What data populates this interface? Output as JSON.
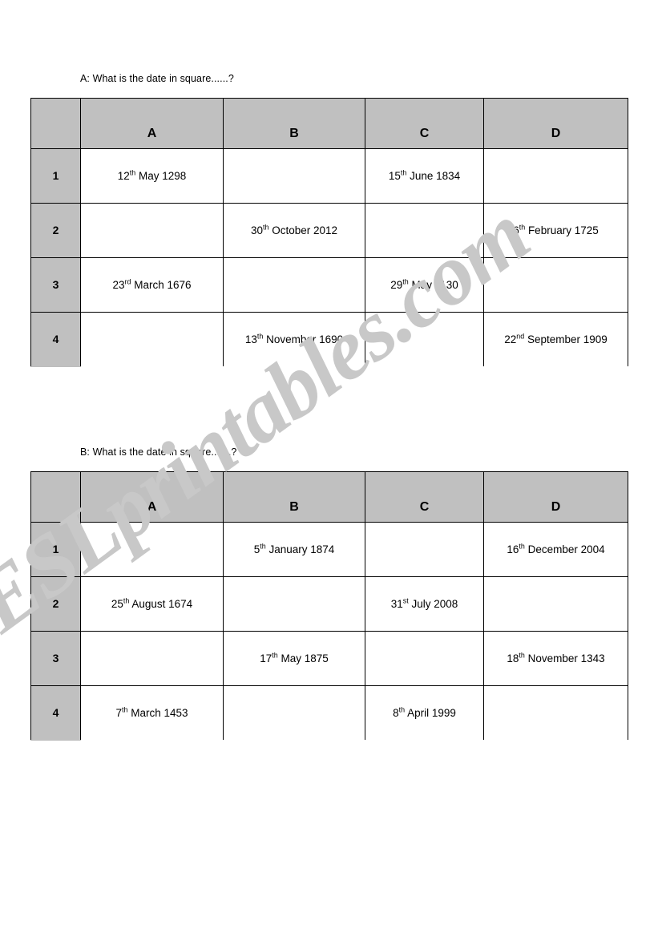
{
  "watermark": {
    "text": "ESLprintables.com"
  },
  "colors": {
    "header_fill": "#C0C0C0",
    "rownum_fill": "#C0C0C0",
    "border": "#000000",
    "text": "#000000",
    "watermark": "#C8C8C8"
  },
  "sections": [
    {
      "id": "a",
      "prompt": "A: What is the date in square......?",
      "columns": [
        "",
        "A",
        "B",
        "C",
        "D"
      ],
      "rows": [
        {
          "label": "1",
          "cells": [
            {
              "day": "12",
              "suffix": "th",
              "rest": " May 1298"
            },
            {
              "day": "",
              "suffix": "",
              "rest": ""
            },
            {
              "day": "15",
              "suffix": "th",
              "rest": " June 1834"
            },
            {
              "day": "",
              "suffix": "",
              "rest": ""
            }
          ]
        },
        {
          "label": "2",
          "cells": [
            {
              "day": "",
              "suffix": "",
              "rest": ""
            },
            {
              "day": "30",
              "suffix": "th",
              "rest": " October 2012"
            },
            {
              "day": "",
              "suffix": "",
              "rest": ""
            },
            {
              "day": "6",
              "suffix": "th",
              "rest": " February 1725"
            }
          ]
        },
        {
          "label": "3",
          "cells": [
            {
              "day": "23",
              "suffix": "rd",
              "rest": " March 1676"
            },
            {
              "day": "",
              "suffix": "",
              "rest": ""
            },
            {
              "day": "29",
              "suffix": "th",
              "rest": "  May 1130"
            },
            {
              "day": "",
              "suffix": "",
              "rest": ""
            }
          ]
        },
        {
          "label": "4",
          "cells": [
            {
              "day": "",
              "suffix": "",
              "rest": ""
            },
            {
              "day": "13",
              "suffix": "th",
              "rest": " November 1690"
            },
            {
              "day": "",
              "suffix": "",
              "rest": ""
            },
            {
              "day": "22",
              "suffix": "nd",
              "rest": " September 1909"
            }
          ]
        }
      ]
    },
    {
      "id": "b",
      "prompt": "B: What is the date in square.......?",
      "columns": [
        "",
        "A",
        "B",
        "C",
        "D"
      ],
      "rows": [
        {
          "label": "1",
          "cells": [
            {
              "day": "",
              "suffix": "",
              "rest": ""
            },
            {
              "day": "5",
              "suffix": "th",
              "rest": " January 1874"
            },
            {
              "day": "",
              "suffix": "",
              "rest": ""
            },
            {
              "day": "16",
              "suffix": "th",
              "rest": " December 2004"
            }
          ]
        },
        {
          "label": "2",
          "cells": [
            {
              "day": "25",
              "suffix": "th",
              "rest": " August 1674"
            },
            {
              "day": "",
              "suffix": "",
              "rest": ""
            },
            {
              "day": "31",
              "suffix": "st",
              "rest": " July 2008"
            },
            {
              "day": "",
              "suffix": "",
              "rest": ""
            }
          ]
        },
        {
          "label": "3",
          "cells": [
            {
              "day": "",
              "suffix": "",
              "rest": ""
            },
            {
              "day": "17",
              "suffix": "th",
              "rest": " May 1875"
            },
            {
              "day": "",
              "suffix": "",
              "rest": ""
            },
            {
              "day": "18",
              "suffix": "th",
              "rest": " November 1343"
            }
          ]
        },
        {
          "label": "4",
          "cells": [
            {
              "day": "7",
              "suffix": "th",
              "rest": " March 1453"
            },
            {
              "day": "",
              "suffix": "",
              "rest": ""
            },
            {
              "day": "8",
              "suffix": "th",
              "rest": " April 1999"
            },
            {
              "day": "",
              "suffix": "",
              "rest": ""
            }
          ]
        }
      ]
    }
  ]
}
